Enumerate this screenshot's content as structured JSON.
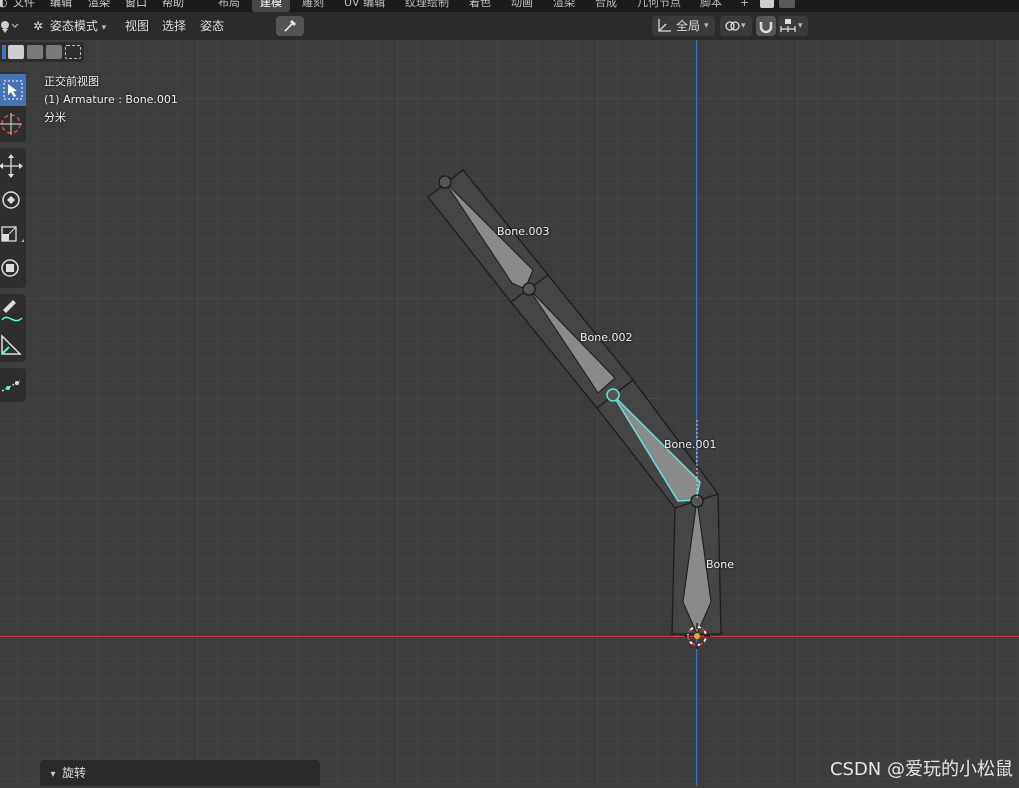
{
  "top_menu": {
    "items": [
      "文件",
      "编辑",
      "渲染",
      "窗口",
      "帮助"
    ],
    "workspaces": [
      "布局",
      "建模",
      "雕刻",
      "UV 编辑",
      "纹理绘制",
      "着色",
      "动画",
      "渲染",
      "合成",
      "几何节点",
      "脚本"
    ],
    "active_workspace": "建模",
    "add_tab": "+"
  },
  "header": {
    "mode": "姿态模式",
    "menus": [
      "视图",
      "选择",
      "姿态"
    ],
    "orientation": "全局"
  },
  "viewport": {
    "view_name": "正交前视图",
    "object_info": "(1) Armature : Bone.001",
    "units": "分米"
  },
  "bones": [
    {
      "name": "Bone.003"
    },
    {
      "name": "Bone.002"
    },
    {
      "name": "Bone.001",
      "selected": true
    },
    {
      "name": "Bone"
    }
  ],
  "redo_panel": {
    "title": "旋转"
  },
  "watermark": "CSDN @爱玩的小松鼠",
  "colors": {
    "selected": "#5fe6e0",
    "x_axis": "#c8374a",
    "z_axis": "#3d6fc8",
    "active_tool": "#4772b3"
  }
}
